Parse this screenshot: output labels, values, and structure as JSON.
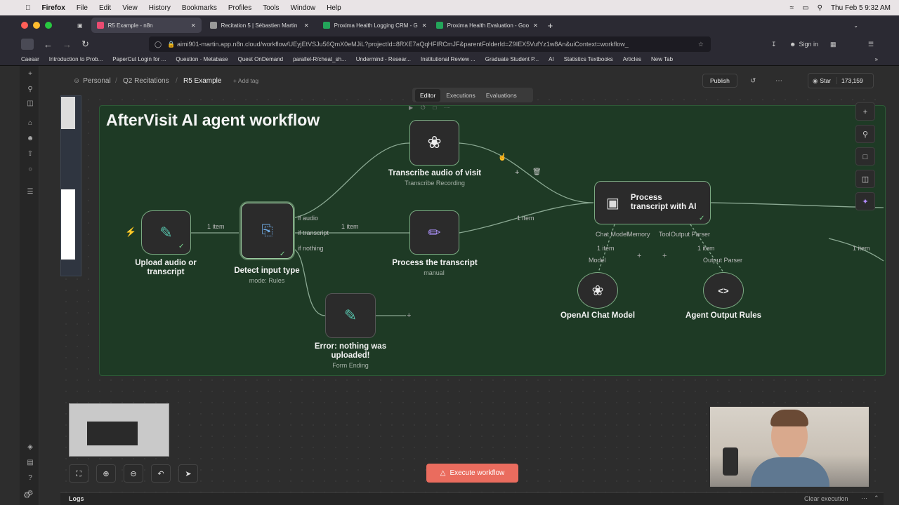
{
  "menubar": {
    "app": "Firefox",
    "items": [
      "File",
      "Edit",
      "View",
      "History",
      "Bookmarks",
      "Profiles",
      "Tools",
      "Window",
      "Help"
    ],
    "clock": "Thu Feb 5  9:32 AM"
  },
  "tabs": [
    {
      "label": "R5 Example - n8n",
      "color": "#ea4b71"
    },
    {
      "label": "Recitation 5 | Sébastien Martin",
      "color": "#999999"
    },
    {
      "label": "Proxima Health Logging CRM - G",
      "color": "#23a55a"
    },
    {
      "label": "Proxima Health Evaluation - Goo",
      "color": "#23a55a"
    }
  ],
  "url": "aimi901-martin.app.n8n.cloud/workflow/UEyjEtVSJu56QmX0eMJiL?projectId=8RXE7aQqHFIRCmJF&parentFolderId=Z9IEX5VufYz1w8An&uiContext=workflow_",
  "signin": "Sign in",
  "bookmarks": [
    "Caesar",
    "Introduction to Prob...",
    "PaperCut Login for ...",
    "Question · Metabase",
    "Quest OnDemand",
    "parallel-R/cheat_sh...",
    "Undermind - Resear...",
    "Institutional Review ...",
    "Graduate Student P...",
    "AI",
    "Statistics Textbooks",
    "Articles",
    "New Tab"
  ],
  "breadcrumb": {
    "personal": "Personal",
    "sep": "/",
    "folder": "Q2 Recitations",
    "workflow": "R5 Example",
    "add_tag": "+ Add tag"
  },
  "header": {
    "publish": "Publish",
    "star": "Star",
    "star_count": "173,159"
  },
  "view_tabs": [
    "Editor",
    "Executions",
    "Evaluations"
  ],
  "sticky_title": "AfterVisit AI agent workflow",
  "nodes": {
    "upload": {
      "title": "Upload audio or transcript"
    },
    "detect": {
      "title": "Detect input type",
      "sub": "mode: Rules"
    },
    "transcribe": {
      "title": "Transcribe audio of visit",
      "sub": "Transcribe Recording"
    },
    "process_manual": {
      "title": "Process the transcript",
      "sub": "manual"
    },
    "error": {
      "title": "Error: nothing was uploaded!",
      "sub": "Form Ending"
    },
    "agent": {
      "title": "Process transcript with AI"
    },
    "openai": {
      "title": "OpenAI Chat Model"
    },
    "parser": {
      "title": "Agent Output Rules"
    }
  },
  "switch_outputs": [
    "if audio",
    "if transcript",
    "if nothing"
  ],
  "edge_labels": {
    "e1": "1 item",
    "e2": "1 item",
    "e3": "1 item",
    "e4": "1 item",
    "e5": "1 item",
    "e6": "1 item"
  },
  "agent_ports": {
    "chat": "Chat Model",
    "memory": "Memory",
    "tool": "Tool",
    "parser": "Output Parser"
  },
  "sub_labels": {
    "model": "Model",
    "output_parser": "Output Parser"
  },
  "execute": "Execute workflow",
  "logs": "Logs",
  "clear": "Clear execution"
}
